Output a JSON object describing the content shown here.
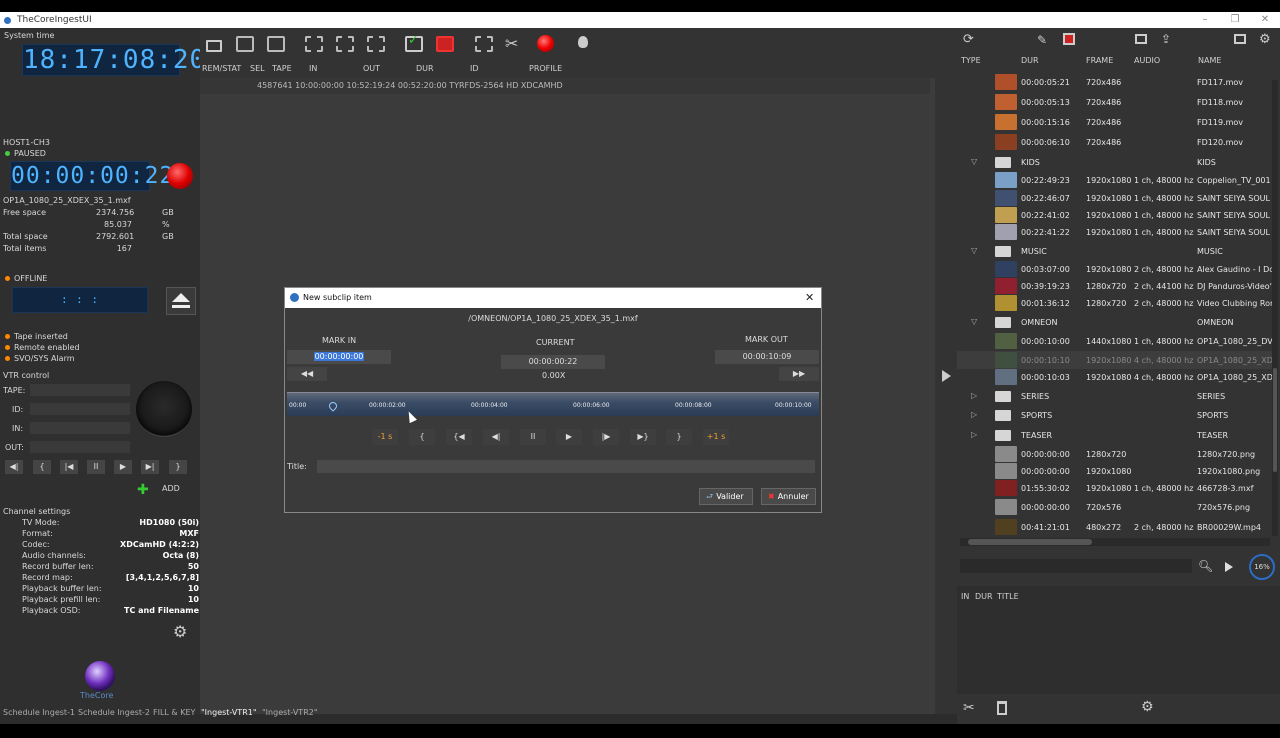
{
  "window": {
    "title": "TheCoreIngestUI",
    "minimize": "–",
    "maximize": "❐",
    "close": "✕"
  },
  "left": {
    "system_time_label": "System time",
    "system_time": "18:17:08:20",
    "host": "HOST1-CH3",
    "status": "PAUSED",
    "timecode": "00:00:00:22",
    "filename": "OP1A_1080_25_XDEX_35_1.mxf",
    "stats": [
      {
        "label": "Free space",
        "value": "2374.756",
        "unit": "GB"
      },
      {
        "label": "",
        "value": "85.037",
        "unit": "%"
      },
      {
        "label": "Total space",
        "value": "2792.601",
        "unit": "GB"
      },
      {
        "label": "Total items",
        "value": "167",
        "unit": ""
      }
    ],
    "offline": "OFFLINE",
    "offline_tc": ":   :   :",
    "alerts": [
      "Tape inserted",
      "Remote enabled",
      "SVO/SYS Alarm"
    ],
    "vtr_title": "VTR control",
    "vtr_fields": [
      "TAPE:",
      "ID:",
      "IN:",
      "OUT:"
    ],
    "vtr_buttons": [
      "◀|",
      "{",
      "|◀",
      "II",
      "▶",
      "▶|",
      "}"
    ],
    "add_label": "ADD",
    "channel_title": "Channel settings",
    "settings": [
      {
        "label": "TV Mode:",
        "value": "HD1080 (50i)"
      },
      {
        "label": "Format:",
        "value": "MXF"
      },
      {
        "label": "Codec:",
        "value": "XDCamHD (4:2:2)"
      },
      {
        "label": "Audio channels:",
        "value": "Octa (8)"
      },
      {
        "label": "Record buffer len:",
        "value": "50"
      },
      {
        "label": "Record map:",
        "value": "[3,4,1,2,5,6,7,8]"
      },
      {
        "label": "Playback buffer len:",
        "value": "10"
      },
      {
        "label": "Playback prefill len:",
        "value": "10"
      },
      {
        "label": "Playback OSD:",
        "value": "TC and Filename"
      }
    ],
    "logo_text": "TheCore"
  },
  "toolbar": {
    "headers": [
      "REM/STAT",
      "SEL",
      "TAPE",
      "IN",
      "OUT",
      "DUR",
      "ID",
      "PROFILE"
    ],
    "row": "4587641  10:00:00:00  10:52:19:24  00:52:20:00  TYRFDS-2564  HD XDCAMHD"
  },
  "bottom_tabs": [
    "Schedule Ingest-1",
    "Schedule Ingest-2",
    "FILL & KEY",
    "\"Ingest-VTR1\"",
    "\"Ingest-VTR2\""
  ],
  "dialog": {
    "title": "New subclip item",
    "path": "/OMNEON/OP1A_1080_25_XDEX_35_1.mxf",
    "mark_in_label": "MARK IN",
    "mark_in": "00:00:00:00",
    "current_label": "CURRENT",
    "current": "00:00:00:22",
    "speed": "0.00X",
    "mark_out_label": "MARK OUT",
    "mark_out": "00:00:10:09",
    "rew": "◀◀",
    "ffw": "▶▶",
    "ticks": [
      "00:00",
      "00:00:02:00",
      "00:00:04:00",
      "00:00:06:00",
      "00:00:08:00",
      "00:00:10:00"
    ],
    "controls": [
      "-1 s",
      "{",
      "{◀",
      "◀|",
      "II",
      "▶",
      "|▶",
      "▶}",
      "}",
      "+1 s"
    ],
    "title_label": "Title:",
    "ok": "Valider",
    "cancel": "Annuler"
  },
  "right": {
    "headers": [
      "TYPE",
      "DUR",
      "FRAME",
      "AUDIO",
      "NAME"
    ],
    "rows": [
      {
        "kind": "file",
        "dur": "00:00:05:21",
        "frame": "720x486",
        "audio": "",
        "name": "FD117.mov",
        "color": "#b0502a"
      },
      {
        "kind": "file",
        "dur": "00:00:05:13",
        "frame": "720x486",
        "audio": "",
        "name": "FD118.mov",
        "color": "#c06030"
      },
      {
        "kind": "file",
        "dur": "00:00:15:16",
        "frame": "720x486",
        "audio": "",
        "name": "FD119.mov",
        "color": "#c87030"
      },
      {
        "kind": "file",
        "dur": "00:00:06:10",
        "frame": "720x486",
        "audio": "",
        "name": "FD120.mov",
        "color": "#8a4020"
      },
      {
        "kind": "folder",
        "open": true,
        "dur": "KIDS",
        "name": "KIDS"
      },
      {
        "kind": "file",
        "dur": "00:22:49:23",
        "frame": "1920x1080",
        "audio": "1 ch, 48000 hz",
        "name": "Coppelion_TV_001",
        "color": "#7aa0c8"
      },
      {
        "kind": "file",
        "dur": "00:22:46:07",
        "frame": "1920x1080",
        "audio": "1 ch, 48000 hz",
        "name": "SAINT SEIYA SOUL",
        "color": "#405070"
      },
      {
        "kind": "file",
        "dur": "00:22:41:02",
        "frame": "1920x1080",
        "audio": "1 ch, 48000 hz",
        "name": "SAINT SEIYA SOUL",
        "color": "#c0a050"
      },
      {
        "kind": "file",
        "dur": "00:22:41:22",
        "frame": "1920x1080",
        "audio": "1 ch, 48000 hz",
        "name": "SAINT SEIYA SOUL",
        "color": "#a0a0b0"
      },
      {
        "kind": "folder",
        "open": true,
        "dur": "MUSIC",
        "name": "MUSIC"
      },
      {
        "kind": "file",
        "dur": "00:03:07:00",
        "frame": "1920x1080",
        "audio": "2 ch, 48000 hz",
        "name": "Alex Gaudino - I Do",
        "color": "#304060"
      },
      {
        "kind": "file",
        "dur": "00:39:19:23",
        "frame": "1280x720",
        "audio": "2 ch, 44100 hz",
        "name": "DJ Panduros-Video'",
        "color": "#902030"
      },
      {
        "kind": "file",
        "dur": "00:01:36:12",
        "frame": "1280x720",
        "audio": "2 ch, 48000 hz",
        "name": "Video Clubbing Ror",
        "color": "#b09030"
      },
      {
        "kind": "folder",
        "open": true,
        "dur": "OMNEON",
        "name": "OMNEON"
      },
      {
        "kind": "file",
        "dur": "00:00:10:00",
        "frame": "1440x1080",
        "audio": "1 ch, 48000 hz",
        "name": "OP1A_1080_25_DV",
        "color": "#506040"
      },
      {
        "kind": "file",
        "dur": "00:00:10:10",
        "frame": "1920x1080",
        "audio": "4 ch, 48000 hz",
        "name": "OP1A_1080_25_XD",
        "color": "#405040",
        "dim": true
      },
      {
        "kind": "file",
        "dur": "00:00:10:03",
        "frame": "1920x1080",
        "audio": "4 ch, 48000 hz",
        "name": "OP1A_1080_25_XD",
        "color": "#607080"
      },
      {
        "kind": "folder",
        "open": false,
        "dur": "SERIES",
        "name": "SERIES"
      },
      {
        "kind": "folder",
        "open": false,
        "dur": "SPORTS",
        "name": "SPORTS"
      },
      {
        "kind": "folder",
        "open": false,
        "dur": "TEASER",
        "name": "TEASER"
      },
      {
        "kind": "file",
        "dur": "00:00:00:00",
        "frame": "1280x720",
        "audio": "",
        "name": "1280x720.png",
        "color": "#8a8a8a"
      },
      {
        "kind": "file",
        "dur": "00:00:00:00",
        "frame": "1920x1080",
        "audio": "",
        "name": "1920x1080.png",
        "color": "#8a8a8a"
      },
      {
        "kind": "file",
        "dur": "01:55:30:02",
        "frame": "1920x1080",
        "audio": "1 ch, 48000 hz",
        "name": "466728-3.mxf",
        "color": "#802020"
      },
      {
        "kind": "file",
        "dur": "00:00:00:00",
        "frame": "720x576",
        "audio": "",
        "name": "720x576.png",
        "color": "#8a8a8a"
      },
      {
        "kind": "file",
        "dur": "00:41:21:01",
        "frame": "480x272",
        "audio": "2 ch, 48000 hz",
        "name": "BR00029W.mp4",
        "color": "#504020"
      }
    ],
    "progress": "16%",
    "bottom_headers": [
      "IN",
      "DUR",
      "TITLE"
    ]
  }
}
